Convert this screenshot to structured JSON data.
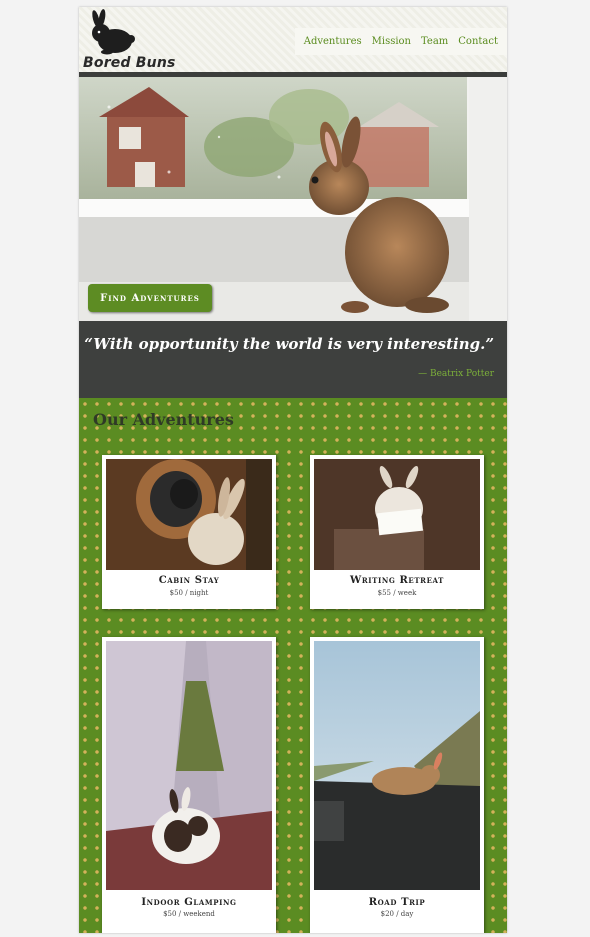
{
  "brand": {
    "name": "Bored Buns",
    "logo_icon": "rabbit-silhouette-icon"
  },
  "nav": {
    "items": [
      "Adventures",
      "Mission",
      "Team",
      "Contact"
    ]
  },
  "hero": {
    "cta_label": "Find Adventures",
    "image": "rabbit-on-windowsill"
  },
  "quote": {
    "text": "“With opportunity the world is very interesting.”",
    "author": "— Beatrix Potter"
  },
  "adventures": {
    "title": "Our Adventures",
    "cards": [
      {
        "name": "Cabin Stay",
        "price": "$50 / night",
        "image": "rabbits-cabin"
      },
      {
        "name": "Writing Retreat",
        "price": "$55 / week",
        "image": "rabbit-with-note"
      },
      {
        "name": "Indoor Glamping",
        "price": "$50 / weekend",
        "image": "rabbit-in-tent"
      },
      {
        "name": "Road Trip",
        "price": "$20 / day",
        "image": "rabbit-on-dashboard"
      }
    ]
  },
  "colors": {
    "accent": "#5d8c23",
    "dark": "#3e403e",
    "link": "#5a8c1e",
    "pattern_dot": "#d3b25a"
  }
}
